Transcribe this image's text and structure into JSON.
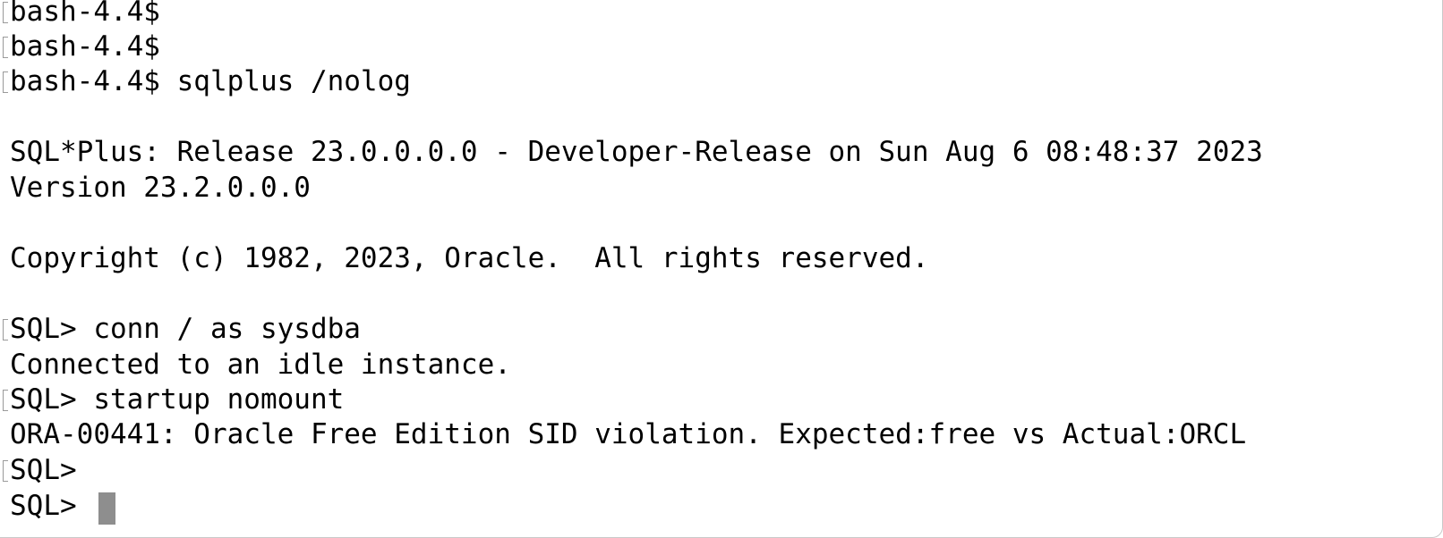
{
  "terminal": {
    "lines": [
      "bash-4.4$",
      "bash-4.4$",
      "bash-4.4$ sqlplus /nolog",
      "",
      "SQL*Plus: Release 23.0.0.0.0 - Developer-Release on Sun Aug 6 08:48:37 2023",
      "Version 23.2.0.0.0",
      "",
      "Copyright (c) 1982, 2023, Oracle.  All rights reserved.",
      "",
      "SQL> conn / as sysdba",
      "Connected to an idle instance.",
      "SQL> startup nomount",
      "ORA-00441: Oracle Free Edition SID violation. Expected:free vs Actual:ORCL",
      "SQL>",
      "SQL> "
    ]
  }
}
